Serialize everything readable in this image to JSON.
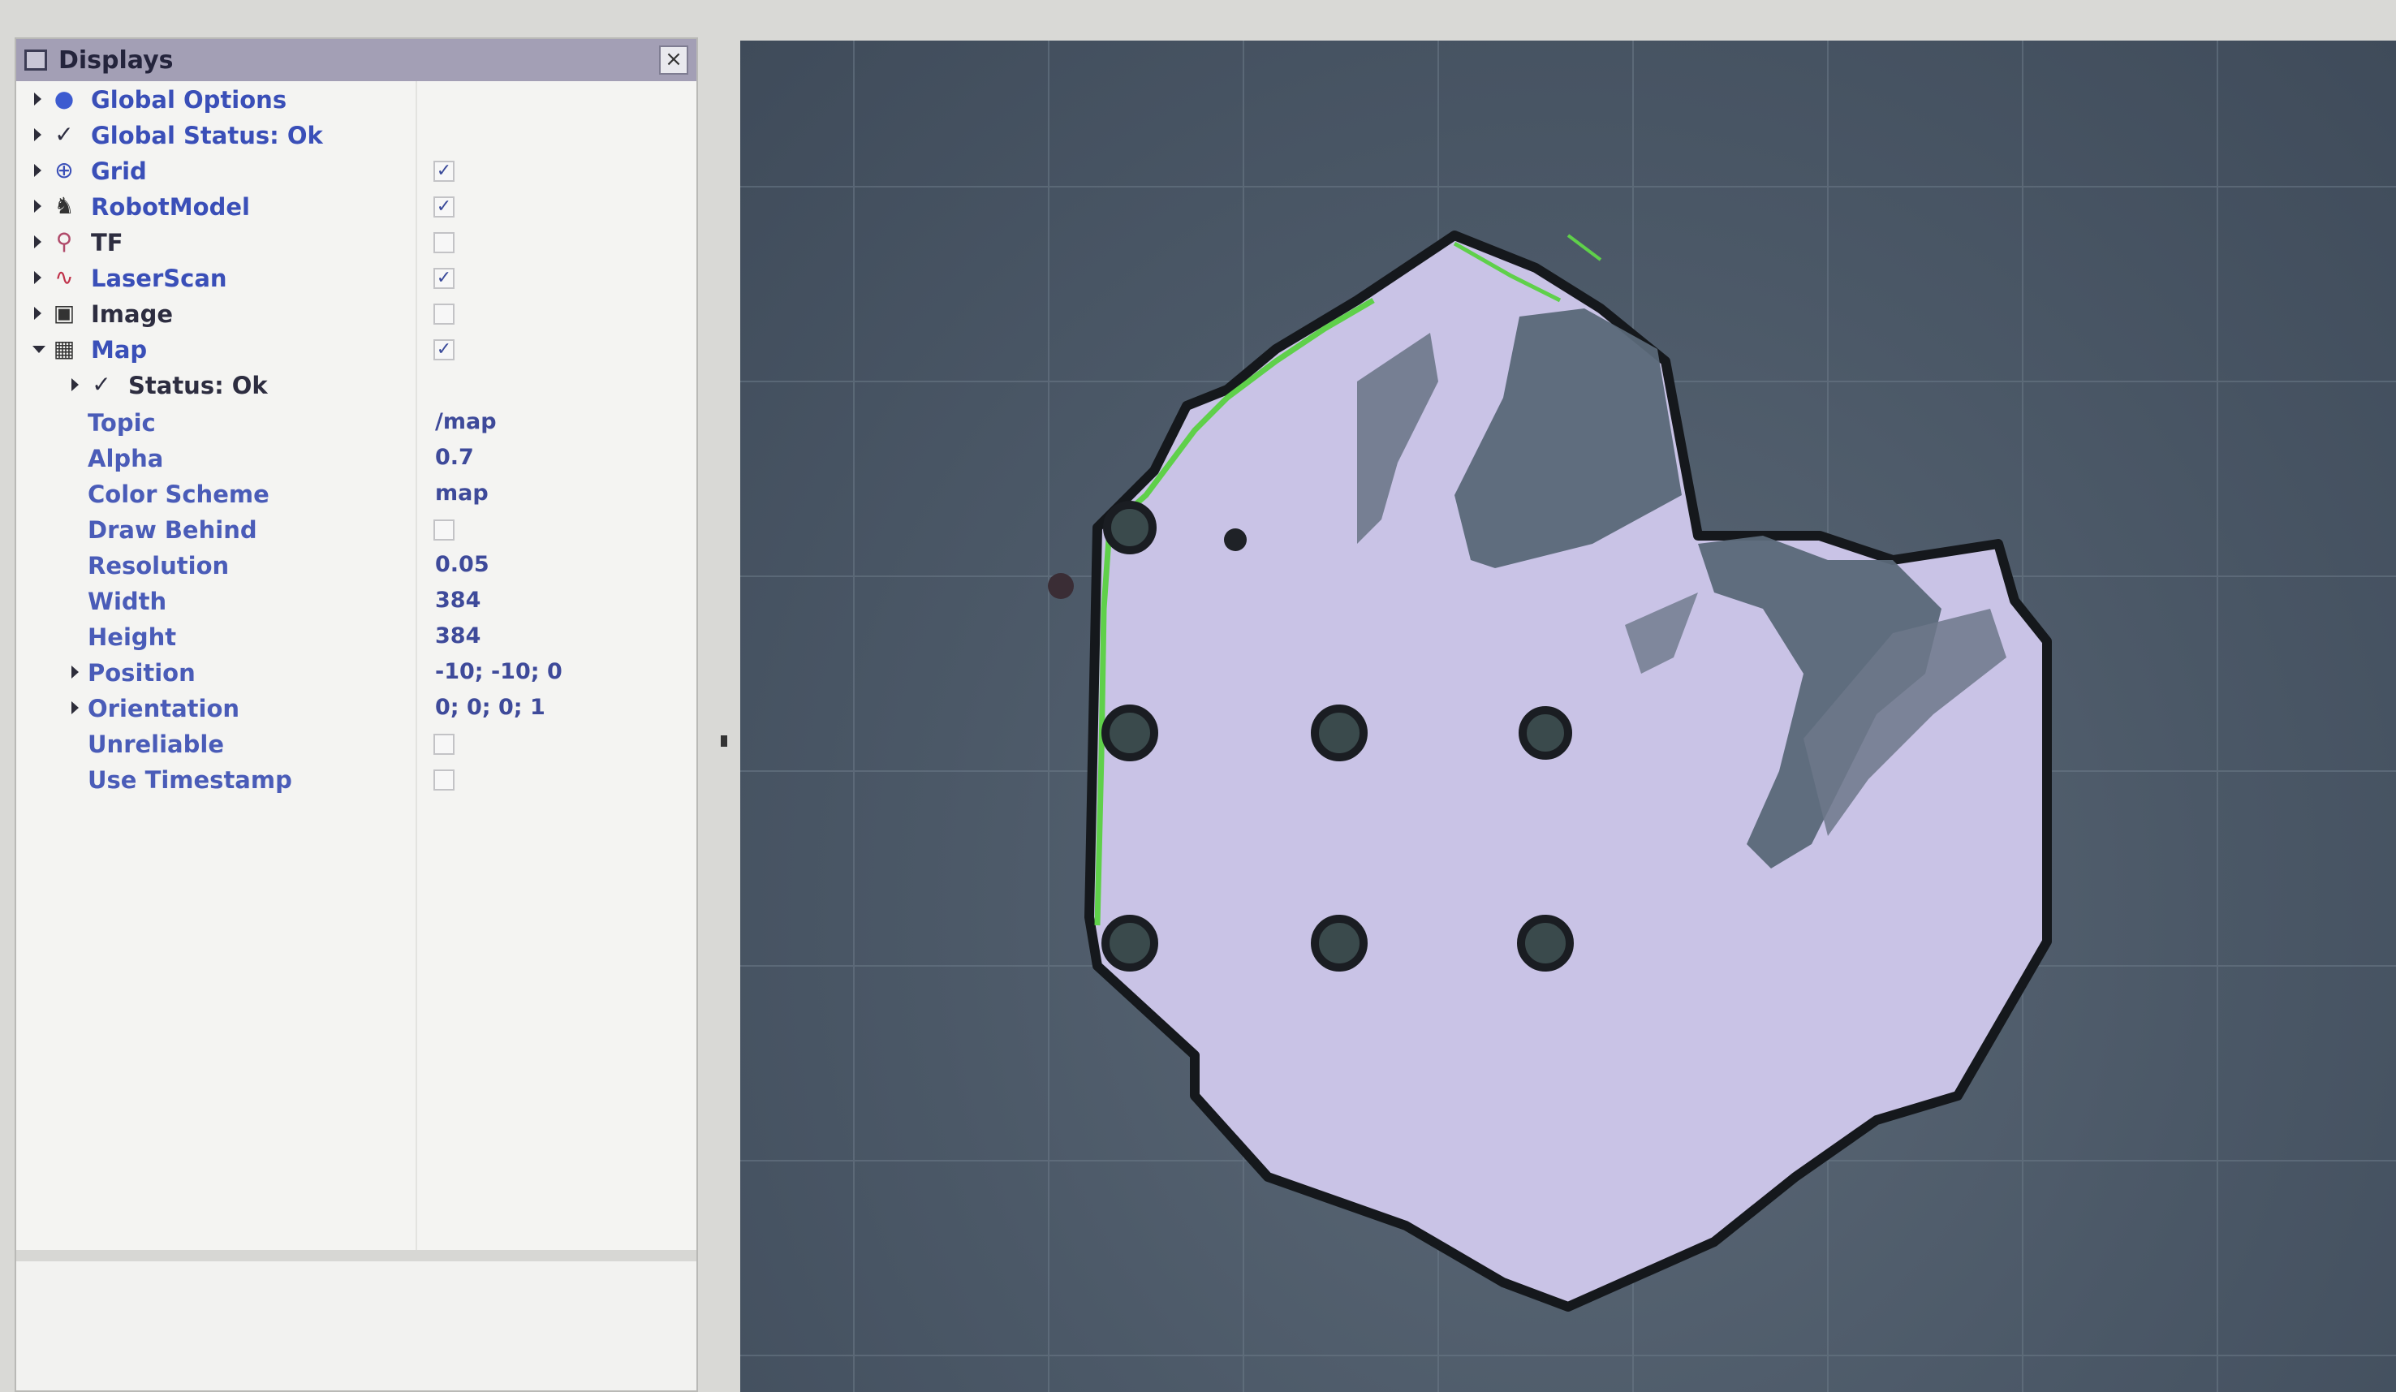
{
  "panel": {
    "title": "Displays",
    "close_glyph": "×"
  },
  "tree": [
    {
      "label": "Global Options",
      "icon": "globe-icon",
      "expanded": false,
      "style": "blue",
      "checkbox": null
    },
    {
      "label": "Global Status: Ok",
      "icon": "check-icon",
      "expanded": false,
      "style": "blue",
      "checkbox": null
    },
    {
      "label": "Grid",
      "icon": "grid-icon",
      "expanded": false,
      "style": "blue",
      "checkbox": true
    },
    {
      "label": "RobotModel",
      "icon": "robot-icon",
      "expanded": false,
      "style": "blue",
      "checkbox": true
    },
    {
      "label": "TF",
      "icon": "tf-icon",
      "expanded": false,
      "style": "dark",
      "checkbox": false
    },
    {
      "label": "LaserScan",
      "icon": "laserscan-icon",
      "expanded": false,
      "style": "blue",
      "checkbox": true
    },
    {
      "label": "Image",
      "icon": "image-icon",
      "expanded": false,
      "style": "dark",
      "checkbox": false
    },
    {
      "label": "Map",
      "icon": "map-icon",
      "expanded": true,
      "style": "blue",
      "checkbox": true
    }
  ],
  "map_props": {
    "status": "Status: Ok",
    "topic_label": "Topic",
    "topic": "/map",
    "alpha_label": "Alpha",
    "alpha": "0.7",
    "color_scheme_label": "Color Scheme",
    "color_scheme": "map",
    "draw_behind_label": "Draw Behind",
    "draw_behind": false,
    "resolution_label": "Resolution",
    "resolution": "0.05",
    "width_label": "Width",
    "width": "384",
    "height_label": "Height",
    "height": "384",
    "position_label": "Position",
    "position": "-10; -10; 0",
    "orientation_label": "Orientation",
    "orientation": "0; 0; 0; 1",
    "unreliable_label": "Unreliable",
    "unreliable": false,
    "use_timestamp_label": "Use Timestamp",
    "use_timestamp": false
  },
  "colors": {
    "map_free": "#c9c3e6",
    "map_unknown": "#5a6878",
    "map_wall": "#1a1d22",
    "laser": "#5fd04a",
    "grid_line": "#6c7a88"
  }
}
